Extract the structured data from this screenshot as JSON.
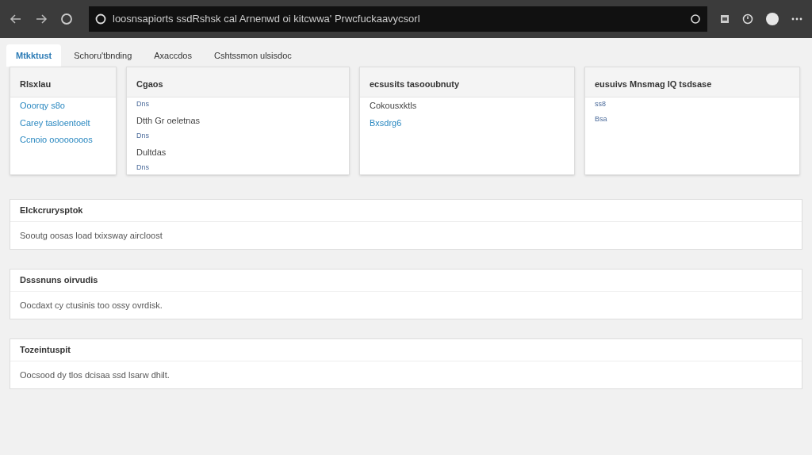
{
  "browser": {
    "address": "loosnsapiorts ssdRshsk cal Arnenwd oi kitcwwa' Prwcfuckaavycsorl"
  },
  "tabs": [
    {
      "label": "Mtkktust",
      "selected": true
    },
    {
      "label": "Schoru'tbnding",
      "selected": false
    },
    {
      "label": "Axaccdos",
      "selected": false
    },
    {
      "label": "Cshtssmon ulsisdoc",
      "selected": false
    }
  ],
  "cards": [
    {
      "title": "Rlsxlau",
      "items": [
        {
          "kind": "link",
          "text": "Ooorqy s8o"
        },
        {
          "kind": "link",
          "text": "Carey tasloentoelt"
        },
        {
          "kind": "link",
          "text": "Ccnoio oooooooos"
        }
      ]
    },
    {
      "title": "Cgaos",
      "items": [
        {
          "kind": "tag",
          "text": "Dns"
        },
        {
          "kind": "text",
          "text": "Dtth Gr oeletnas"
        },
        {
          "kind": "tag",
          "text": "Dns"
        },
        {
          "kind": "text",
          "text": "Dultdas"
        },
        {
          "kind": "tag",
          "text": "Dns"
        }
      ]
    },
    {
      "title": "ecsusits tasooubnuty",
      "items": [
        {
          "kind": "text",
          "text": "Cokousxktls"
        },
        {
          "kind": "link",
          "text": "Bxsdrg6"
        }
      ]
    },
    {
      "title": "eusuivs Mnsmag IQ tsdsase",
      "items": [
        {
          "kind": "tag",
          "text": "ss8"
        },
        {
          "kind": "tag",
          "text": "Bsa"
        }
      ]
    }
  ],
  "panels": [
    {
      "title": "Elckcrurysptok",
      "text": "Sooutg oosas load txixsway aircloost"
    },
    {
      "title": "Dsssnuns oirvudis",
      "text": "Oocdaxt cy ctusinis too ossy ovrdisk."
    },
    {
      "title": "Tozeintuspit",
      "text": "Oocsood dy tlos dcisaa ssd lsarw dhilt."
    }
  ]
}
